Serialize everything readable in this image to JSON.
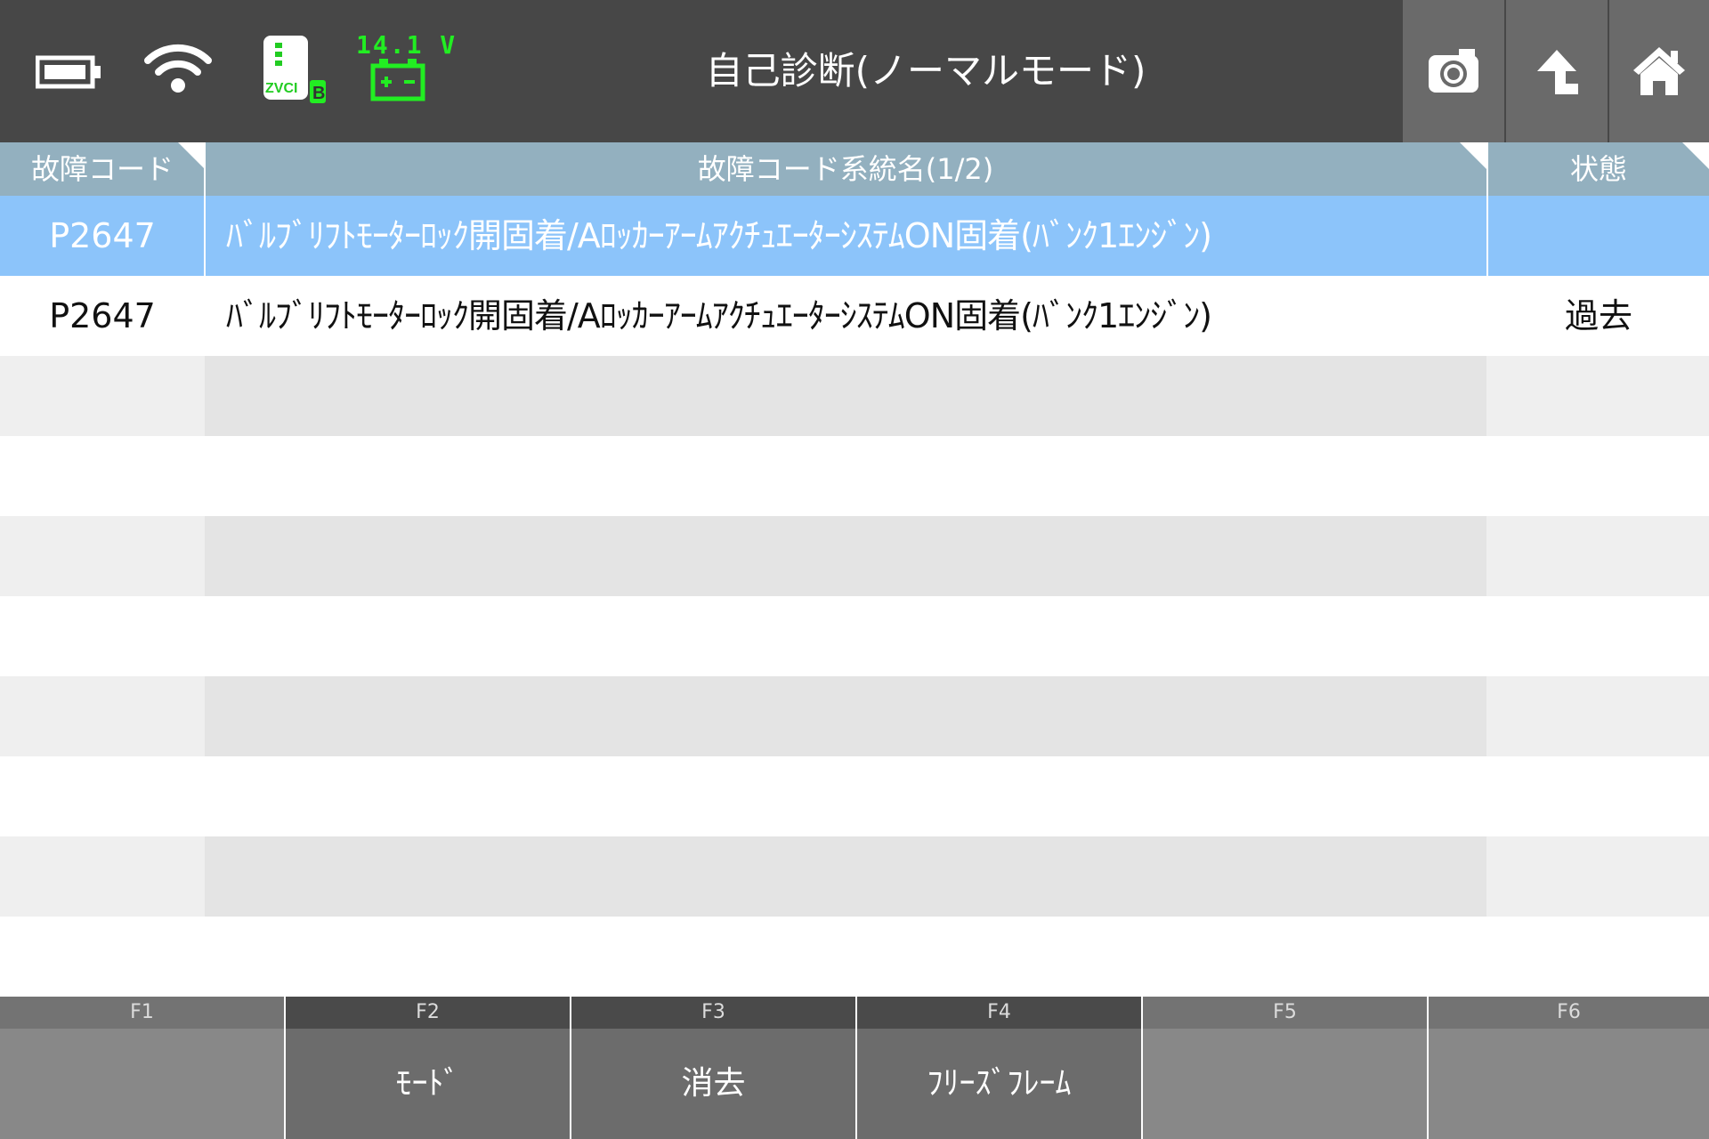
{
  "header": {
    "title": "自己診断(ノーマルモード)",
    "voltage": "14.1 V",
    "zvci_label": "ZVCI",
    "zvci_badge": "B",
    "icons": [
      "battery-icon",
      "wifi-icon",
      "zvci-icon",
      "car-battery-icon",
      "camera-icon",
      "up-arrow-icon",
      "home-icon"
    ],
    "colors": {
      "bar": "#474747",
      "button": "#6a6a6a",
      "voltage": "#22ee22"
    }
  },
  "table": {
    "columns": [
      "故障コード",
      "故障コード系統名(1/2)",
      "状態"
    ],
    "rows": [
      {
        "code": "P2647",
        "name": "ﾊﾞﾙﾌﾞﾘﾌﾄﾓｰﾀｰﾛｯｸ開固着/AﾛｯｶｰｱｰﾑｱｸﾁｭｴｰﾀｰｼｽﾃﾑON固着(ﾊﾞﾝｸ1ｴﾝｼﾞﾝ)",
        "status": ""
      },
      {
        "code": "P2647",
        "name": "ﾊﾞﾙﾌﾞﾘﾌﾄﾓｰﾀｰﾛｯｸ開固着/AﾛｯｶｰｱｰﾑｱｸﾁｭｴｰﾀｰｼｽﾃﾑON固着(ﾊﾞﾝｸ1ｴﾝｼﾞﾝ)",
        "status": "過去"
      }
    ],
    "colors": {
      "header": "#93b0bf",
      "selected": "#8cc4fa"
    }
  },
  "fkeys": [
    {
      "key": "F1",
      "label": ""
    },
    {
      "key": "F2",
      "label": "ﾓｰﾄﾞ"
    },
    {
      "key": "F3",
      "label": "消去"
    },
    {
      "key": "F4",
      "label": "ﾌﾘｰｽﾞﾌﾚｰﾑ"
    },
    {
      "key": "F5",
      "label": ""
    },
    {
      "key": "F6",
      "label": ""
    }
  ]
}
